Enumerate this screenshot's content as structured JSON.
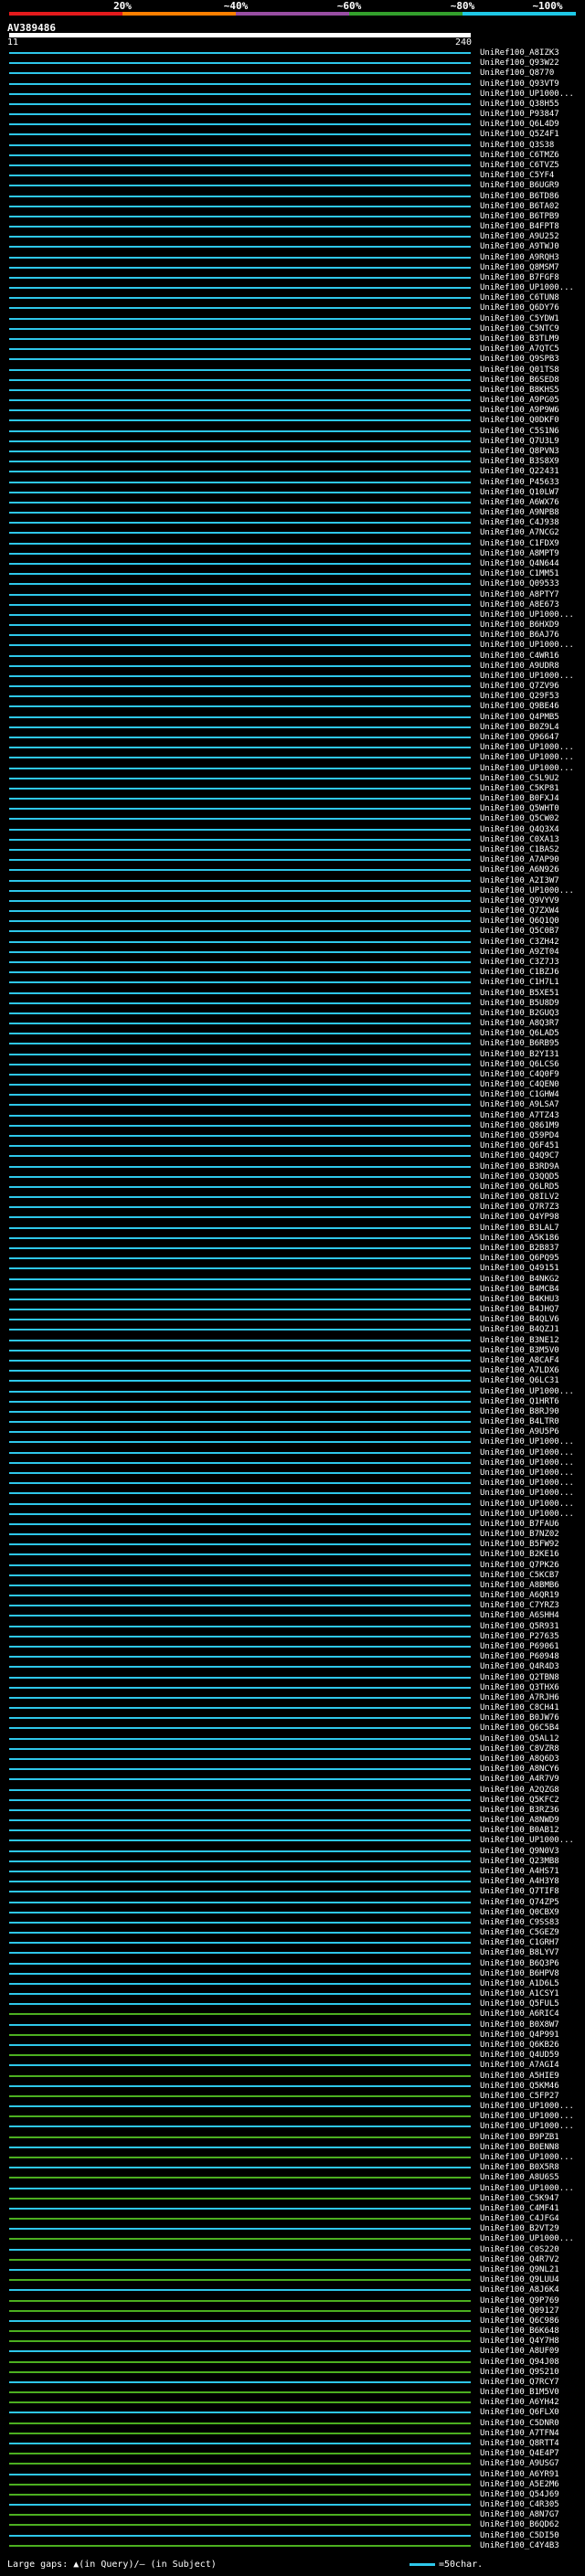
{
  "scale": {
    "labels": [
      "20%",
      "~40%",
      "~60%",
      "~80%",
      "~100%"
    ],
    "colors": [
      "#e41a1c",
      "#ff7f00",
      "#984ea3",
      "#33a02c",
      "#1ec8e6"
    ]
  },
  "query": {
    "name": "AV389486",
    "start": "11",
    "end": "240"
  },
  "colors": {
    "cyan": "#2ec7ea",
    "green": "#4caf20",
    "white": "#ffffff"
  },
  "hits": [
    "UniRef100_A8IZK3",
    "UniRef100_Q93W22",
    "UniRef100_Q8770",
    "UniRef100_Q93VT9",
    "UniRef100_UP1000...",
    "UniRef100_Q38H55",
    "UniRef100_P93847",
    "UniRef100_Q6L4D9",
    "UniRef100_Q5Z4F1",
    "UniRef100_Q3S38",
    "UniRef100_C6TMZ6",
    "UniRef100_C6TVZ5",
    "UniRef100_C5YF4",
    "UniRef100_B6UGR9",
    "UniRef100_B6TD86",
    "UniRef100_B6TA02",
    "UniRef100_B6TPB9",
    "UniRef100_B4FPT8",
    "UniRef100_A9U252",
    "UniRef100_A9TWJ0",
    "UniRef100_A9RQH3",
    "UniRef100_Q8MSM7",
    "UniRef100_B7FGF8",
    "UniRef100_UP1000...",
    "UniRef100_C6TUN8",
    "UniRef100_Q6DY76",
    "UniRef100_C5YDW1",
    "UniRef100_C5NTC9",
    "UniRef100_B3TLM9",
    "UniRef100_A7QTC5",
    "UniRef100_Q9SPB3",
    "UniRef100_Q01TS8",
    "UniRef100_B6SED8",
    "UniRef100_B8KHS5",
    "UniRef100_A9PG05",
    "UniRef100_A9P9W6",
    "UniRef100_Q0DKF0",
    "UniRef100_C5S1N6",
    "UniRef100_Q7U3L9",
    "UniRef100_Q8PVN3",
    "UniRef100_B3S8X9",
    "UniRef100_Q22431",
    "UniRef100_P45633",
    "UniRef100_Q10LW7",
    "UniRef100_A6WX76",
    "UniRef100_A9NPB8",
    "UniRef100_C4J938",
    "UniRef100_A7NCG2",
    "UniRef100_C1FDX9",
    "UniRef100_A8MPT9",
    "UniRef100_Q4N644",
    "UniRef100_C1MM51",
    "UniRef100_Q09533",
    "UniRef100_A8PTY7",
    "UniRef100_A8E673",
    "UniRef100_UP1000...",
    "UniRef100_B6HXD9",
    "UniRef100_B6AJ76",
    "UniRef100_UP1000...",
    "UniRef100_C4WR16",
    "UniRef100_A9UDR8",
    "UniRef100_UP1000...",
    "UniRef100_Q7ZV96",
    "UniRef100_Q29F53",
    "UniRef100_Q9BE46",
    "UniRef100_Q4PMB5",
    "UniRef100_B0Z9L4",
    "UniRef100_Q96647",
    "UniRef100_UP1000...",
    "UniRef100_UP1000...",
    "UniRef100_UP1000...",
    "UniRef100_C5L9U2",
    "UniRef100_C5KP81",
    "UniRef100_B0FXJ4",
    "UniRef100_Q5WHT0",
    "UniRef100_Q5CW02",
    "UniRef100_Q4Q3X4",
    "UniRef100_C0XA13",
    "UniRef100_C1BAS2",
    "UniRef100_A7AP90",
    "UniRef100_A6N926",
    "UniRef100_A2I3W7",
    "UniRef100_UP1000...",
    "UniRef100_Q9VYV9",
    "UniRef100_Q7ZXW4",
    "UniRef100_Q6Q1Q0",
    "UniRef100_Q5C0B7",
    "UniRef100_C3ZH42",
    "UniRef100_A9ZT04",
    "UniRef100_C3Z7J3",
    "UniRef100_C1BZJ6",
    "UniRef100_C1H7L1",
    "UniRef100_B5XE51",
    "UniRef100_B5U8D9",
    "UniRef100_B2GUQ3",
    "UniRef100_A8Q3R7",
    "UniRef100_Q6LAD5",
    "UniRef100_B6RB95",
    "UniRef100_B2YI31",
    "UniRef100_Q6LCS6",
    "UniRef100_C4Q0F9",
    "UniRef100_C4QEN0",
    "UniRef100_C1GHW4",
    "UniRef100_A9LSA7",
    "UniRef100_A7TZ43",
    "UniRef100_Q861M9",
    "UniRef100_Q59PD4",
    "UniRef100_Q6F451",
    "UniRef100_Q4Q9C7",
    "UniRef100_B3RD9A",
    "UniRef100_Q3QQD5",
    "UniRef100_Q6LRD5",
    "UniRef100_Q8ILV2",
    "UniRef100_Q7R7Z3",
    "UniRef100_Q4YP98",
    "UniRef100_B3LAL7",
    "UniRef100_A5K186",
    "UniRef100_B2B837",
    "UniRef100_Q6PQ95",
    "UniRef100_Q49151",
    "UniRef100_B4NKG2",
    "UniRef100_B4MCB4",
    "UniRef100_B4KHU3",
    "UniRef100_B4JHQ7",
    "UniRef100_B4QLV6",
    "UniRef100_B4QZJ1",
    "UniRef100_B3NE12",
    "UniRef100_B3M5V0",
    "UniRef100_A8CAF4",
    "UniRef100_A7LDX6",
    "UniRef100_Q6LC31",
    "UniRef100_UP1000...",
    "UniRef100_Q1HRT6",
    "UniRef100_B8RJ90",
    "UniRef100_B4LTR0",
    "UniRef100_A9U5P6",
    "UniRef100_UP1000...",
    "UniRef100_UP1000...",
    "UniRef100_UP1000...",
    "UniRef100_UP1000...",
    "UniRef100_UP1000...",
    "UniRef100_UP1000...",
    "UniRef100_UP1000...",
    "UniRef100_UP1000...",
    "UniRef100_B7FAU6",
    "UniRef100_B7NZ02",
    "UniRef100_B5FW92",
    "UniRef100_B2KE16",
    "UniRef100_Q7PK26",
    "UniRef100_C5KCB7",
    "UniRef100_A8BMB6",
    "UniRef100_A6QR19",
    "UniRef100_C7YRZ3",
    "UniRef100_A6SHH4",
    "UniRef100_Q5R931",
    "UniRef100_P27635",
    "UniRef100_P69061",
    "UniRef100_P60948",
    "UniRef100_Q4R4D3",
    "UniRef100_Q2TBN8",
    "UniRef100_Q3THX6",
    "UniRef100_A7RJH6",
    "UniRef100_C8CH41",
    "UniRef100_B0JW76",
    "UniRef100_Q6C5B4",
    "UniRef100_Q5AL12",
    "UniRef100_C8VZR8",
    "UniRef100_A8Q6D3",
    "UniRef100_A8NCY6",
    "UniRef100_A4R7V9",
    "UniRef100_A2QZG8",
    "UniRef100_Q5KFC2",
    "UniRef100_B3RZ36",
    "UniRef100_A8NWD9",
    "UniRef100_B0AB12",
    "UniRef100_UP1000...",
    "UniRef100_Q9N0V3",
    "UniRef100_Q23MB8",
    "UniRef100_A4HS71",
    "UniRef100_A4H3Y8",
    "UniRef100_Q7TIF8",
    "UniRef100_Q74ZP5",
    "UniRef100_Q0CBX9",
    "UniRef100_C9SS83",
    "UniRef100_C5GEZ9",
    "UniRef100_C1GRH7",
    "UniRef100_B8LYV7",
    "UniRef100_B6Q3P6",
    "UniRef100_B6HPV8",
    "UniRef100_A1D6L5",
    "UniRef100_A1CSY1",
    "UniRef100_Q5FUL5",
    "UniRef100_A6RIC4",
    "UniRef100_B0X8W7",
    "UniRef100_Q4P991",
    "UniRef100_Q6KB26",
    "UniRef100_Q4UD59",
    "UniRef100_A7AGI4",
    "UniRef100_A5HIE9",
    "UniRef100_Q5KM46",
    "UniRef100_C5FP27",
    "UniRef100_UP1000...",
    "UniRef100_UP1000...",
    "UniRef100_UP1000...",
    "UniRef100_B9PZB1",
    "UniRef100_B0ENN8",
    "UniRef100_UP1000...",
    "UniRef100_B0X5R8",
    "UniRef100_A8U6S5",
    "UniRef100_UP1000...",
    "UniRef100_C5K947",
    "UniRef100_C4MF41",
    "UniRef100_C4JFG4",
    "UniRef100_B2VT29",
    "UniRef100_UP1000...",
    "UniRef100_C0S220",
    "UniRef100_Q4R7V2",
    "UniRef100_Q9NL21",
    "UniRef100_Q9LUU4",
    "UniRef100_A8J6K4",
    "UniRef100_Q9P769",
    "UniRef100_Q09127",
    "UniRef100_Q6C986",
    "UniRef100_B6K648",
    "UniRef100_Q4Y7H8",
    "UniRef100_A8UF09",
    "UniRef100_Q94J08",
    "UniRef100_Q9S210",
    "UniRef100_Q7RCY7",
    "UniRef100_B1M5V0",
    "UniRef100_A6YH42",
    "UniRef100_Q6FLX0",
    "UniRef100_C5DNR0",
    "UniRef100_A7TFN4",
    "UniRef100_Q8RTT4",
    "UniRef100_Q4E4P7",
    "UniRef100_A9USG7",
    "UniRef100_A6YR91",
    "UniRef100_A5E2M6",
    "UniRef100_Q54J69",
    "UniRef100_C4R305",
    "UniRef100_A8N7G7",
    "UniRef100_B6QD62",
    "UniRef100_C5DI50",
    "UniRef100_C4Y4B3"
  ],
  "footer": {
    "gaps_text": "Large gaps: ▲(in Query)/– (in Subject)",
    "scale_text": "=50char."
  }
}
